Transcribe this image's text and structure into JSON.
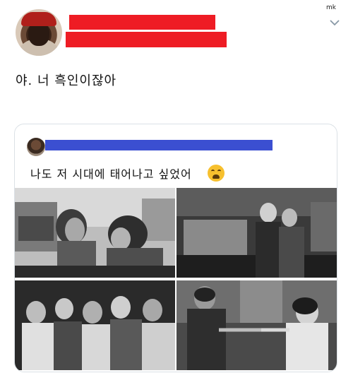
{
  "watermark": "mk",
  "tweet": {
    "text": "야. 너 흑인이잖아",
    "avatar_icon": "profile-avatar",
    "redaction_color": "#ee1c24",
    "menu_icon": "chevron-down-icon"
  },
  "quoted_tweet": {
    "text": "나도 저 시대에 태어나고 싶었어",
    "emoji": "weary-face-emoji",
    "redaction_color": "#3b4fd1",
    "photos": [
      {
        "icon": "vintage-diner-couple-photo"
      },
      {
        "icon": "vintage-soda-fountain-couple-photo"
      },
      {
        "icon": "vintage-dance-crowd-photo"
      },
      {
        "icon": "vintage-dancing-couple-photo"
      }
    ]
  }
}
